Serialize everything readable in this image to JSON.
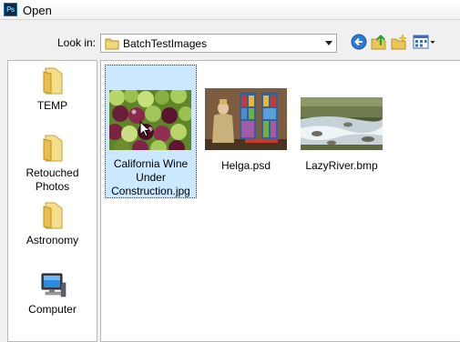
{
  "window": {
    "title": "Open",
    "app_icon_text": "Ps"
  },
  "lookin": {
    "label": "Look in:",
    "value": "BatchTestImages"
  },
  "toolbar": {
    "back_icon": "back-arrow-icon",
    "up_icon": "up-folder-icon",
    "new_folder_icon": "new-folder-icon",
    "views_icon": "views-menu-icon"
  },
  "places": [
    {
      "label": "TEMP",
      "icon": "folder-icon"
    },
    {
      "label": "Retouched Photos",
      "icon": "folder-icon"
    },
    {
      "label": "Astronomy",
      "icon": "folder-icon"
    },
    {
      "label": "Computer",
      "icon": "computer-icon"
    }
  ],
  "files": [
    {
      "label": "California Wine Under Construction.jpg",
      "selected": true
    },
    {
      "label": "Helga.psd",
      "selected": false
    },
    {
      "label": "LazyRiver.bmp",
      "selected": false
    }
  ],
  "colors": {
    "selection": "#cce8ff",
    "folder": "#e8c65a",
    "accent": "#1f6fc9"
  }
}
